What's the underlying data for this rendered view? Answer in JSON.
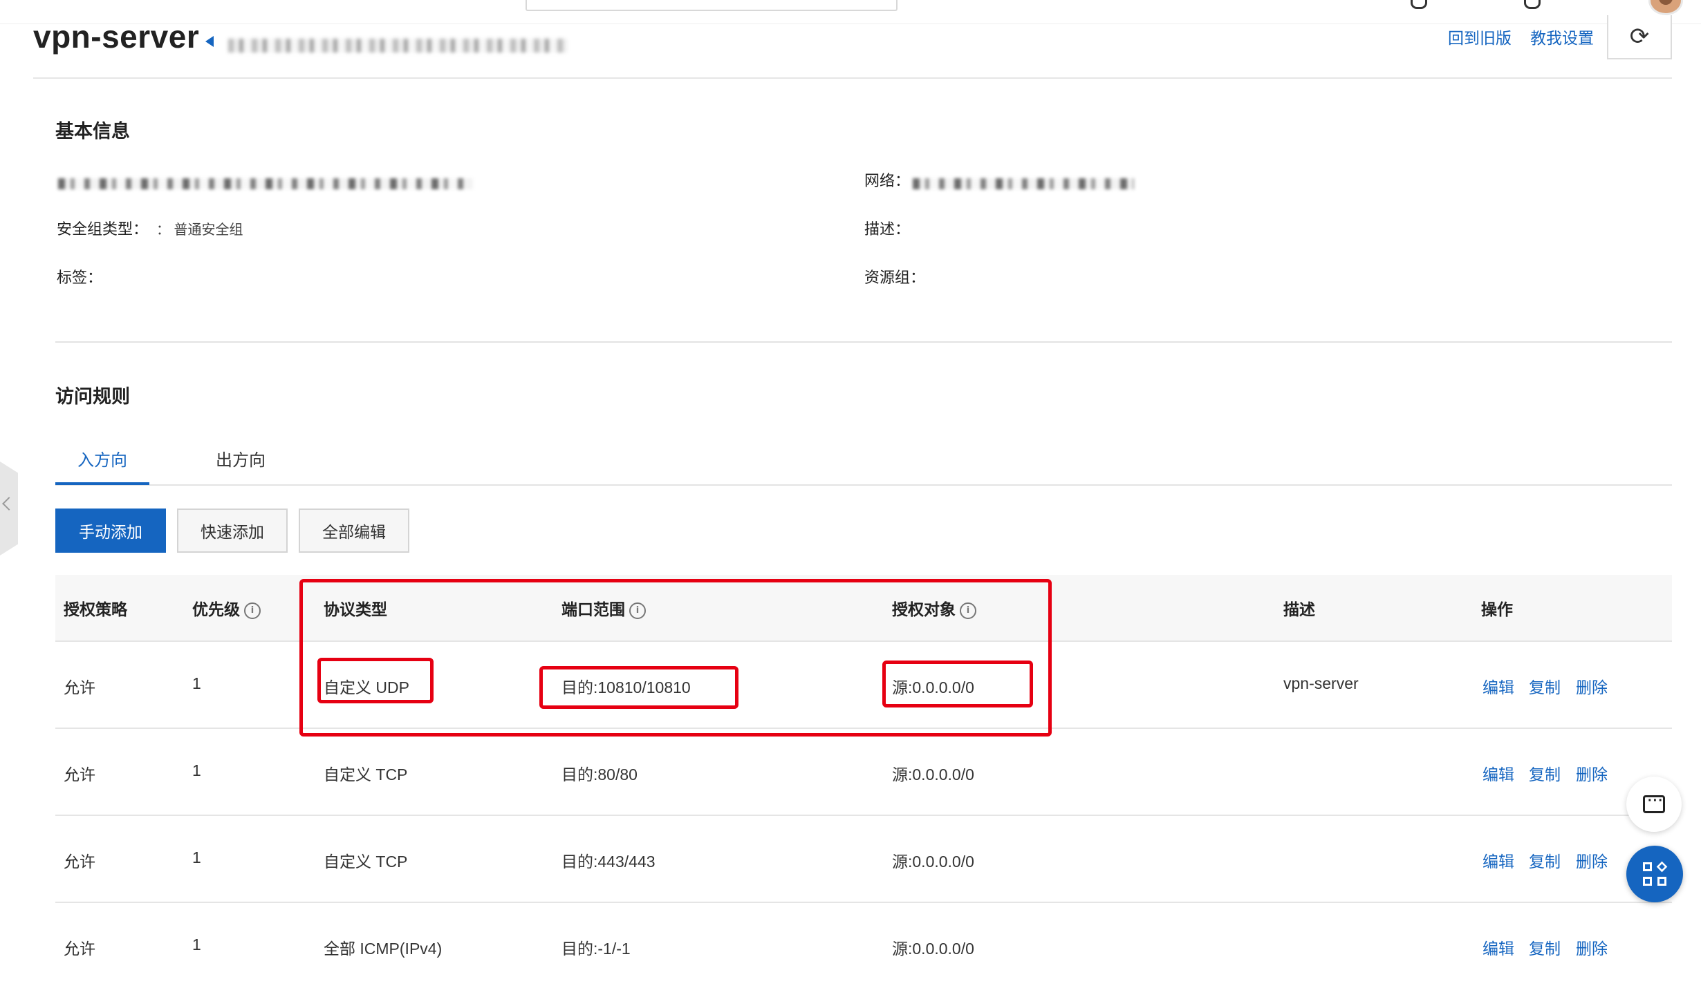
{
  "header": {
    "title": "vpn-server",
    "links": {
      "old_version": "回到旧版",
      "tutorial": "教我设置"
    },
    "refresh_icon": "⟳"
  },
  "basic_info": {
    "section_title": "基本信息",
    "network_label": "网络：",
    "sg_type_label": "安全组类型：",
    "sg_type_value": "：  普通安全组",
    "description_label": "描述：",
    "tags_label": "标签：",
    "resource_group_label": "资源组："
  },
  "access_rules": {
    "section_title": "访问规则",
    "tabs": {
      "inbound": "入方向",
      "outbound": "出方向"
    },
    "buttons": {
      "manual_add": "手动添加",
      "quick_add": "快速添加",
      "edit_all": "全部编辑"
    },
    "columns": {
      "policy": "授权策略",
      "priority": "优先级",
      "protocol": "协议类型",
      "port_range": "端口范围",
      "auth_object": "授权对象",
      "description": "描述",
      "actions": "操作"
    },
    "info_glyph": "i",
    "rows": [
      {
        "policy": "允许",
        "priority": "1",
        "protocol": "自定义 UDP",
        "port": "目的:10810/10810",
        "source": "源:0.0.0.0/0",
        "description": "vpn-server"
      },
      {
        "policy": "允许",
        "priority": "1",
        "protocol": "自定义 TCP",
        "port": "目的:80/80",
        "source": "源:0.0.0.0/0",
        "description": ""
      },
      {
        "policy": "允许",
        "priority": "1",
        "protocol": "自定义 TCP",
        "port": "目的:443/443",
        "source": "源:0.0.0.0/0",
        "description": ""
      },
      {
        "policy": "允许",
        "priority": "1",
        "protocol": "全部 ICMP(IPv4)",
        "port": "目的:-1/-1",
        "source": "源:0.0.0.0/0",
        "description": ""
      }
    ],
    "actions": {
      "edit": "编辑",
      "copy": "复制",
      "delete": "删除"
    }
  },
  "colors": {
    "accent": "#1565c0",
    "highlight": "#e60012"
  }
}
